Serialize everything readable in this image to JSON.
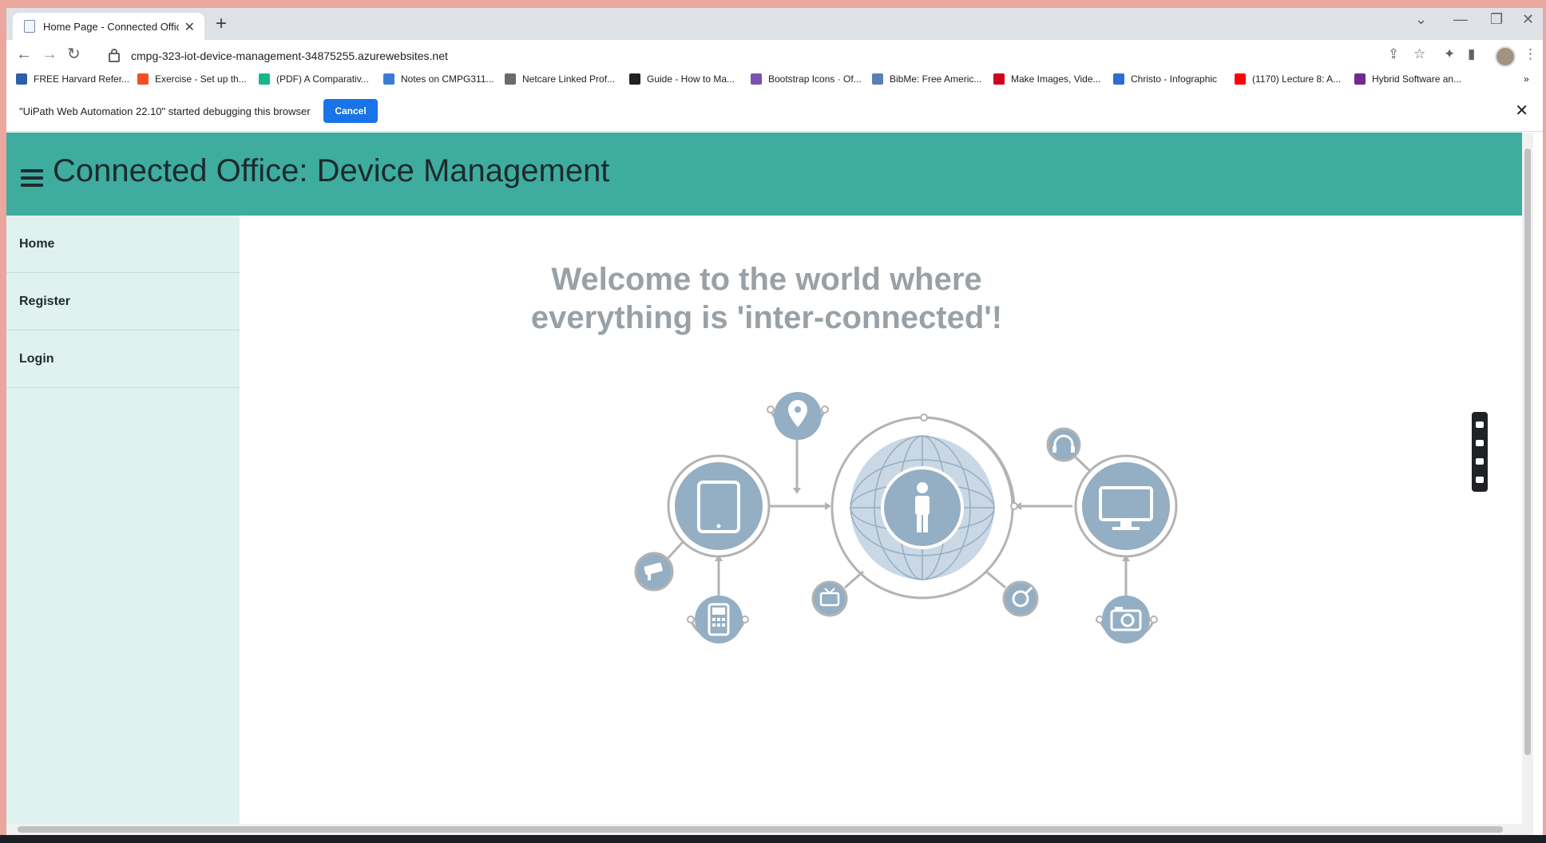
{
  "browser": {
    "tab_title": "Home Page - Connected Office: Device Management",
    "url": "cmpg-323-iot-device-management-34875255.azurewebsites.net",
    "bookmarks": [
      {
        "label": "FREE Harvard Refer...",
        "color": "#2d5fa8"
      },
      {
        "label": "Exercise - Set up th...",
        "color": "#f25022"
      },
      {
        "label": "(PDF) A Comparativ...",
        "color": "#18b58b"
      },
      {
        "label": "Notes on CMPG311...",
        "color": "#3a7bd5"
      },
      {
        "label": "Netcare Linked Prof...",
        "color": "#6b6b6b"
      },
      {
        "label": "Guide - How to Ma...",
        "color": "#222222"
      },
      {
        "label": "Bootstrap Icons · Of...",
        "color": "#7952b3"
      },
      {
        "label": "BibMe: Free Americ...",
        "color": "#5a7fb5"
      },
      {
        "label": "Make Images, Vide...",
        "color": "#d0021b"
      },
      {
        "label": "Christo - Infographic",
        "color": "#2c6dd2"
      },
      {
        "label": "(1170) Lecture 8: A...",
        "color": "#ff0000"
      },
      {
        "label": "Hybrid Software an...",
        "color": "#6d2c91"
      }
    ]
  },
  "infobar": {
    "message": "\"UiPath Web Automation 22.10\" started debugging this browser",
    "cancel_label": "Cancel"
  },
  "app": {
    "title": "Connected Office: Device Management",
    "nav": [
      "Home",
      "Register",
      "Login"
    ],
    "welcome_line1": "Welcome to the world where",
    "welcome_line2": "everything is 'inter-connected'!"
  },
  "colors": {
    "header": "#3ead9f",
    "sidebar": "#dff2f0",
    "icon_fill": "#94aec3",
    "line": "#b3b3b3"
  }
}
